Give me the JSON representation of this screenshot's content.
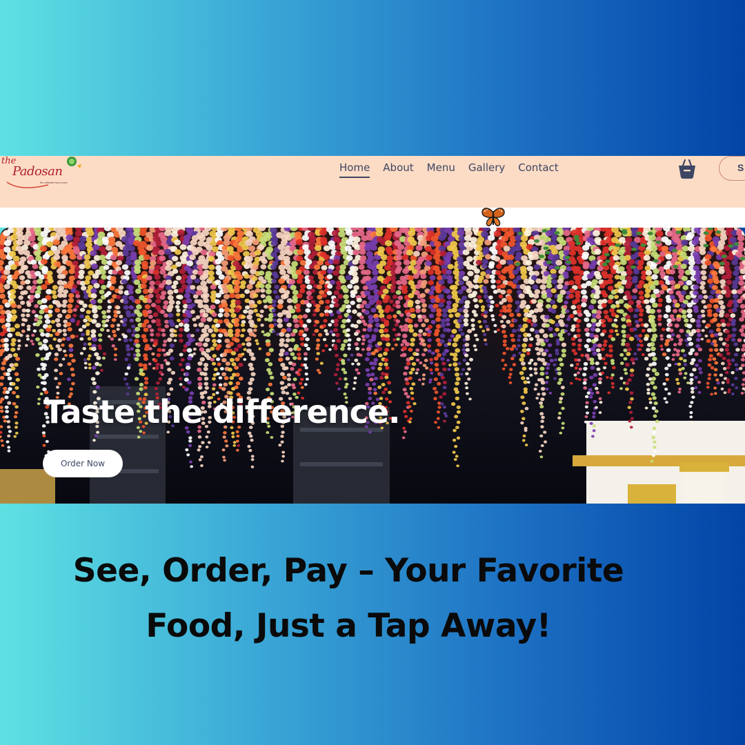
{
  "site": {
    "logo": {
      "the": "the",
      "name": "Padosan",
      "tagline": "the ultimate food court"
    },
    "nav": {
      "items": [
        {
          "label": "Home",
          "active": true
        },
        {
          "label": "About",
          "active": false
        },
        {
          "label": "Menu",
          "active": false
        },
        {
          "label": "Gallery",
          "active": false
        },
        {
          "label": "Contact",
          "active": false
        }
      ]
    },
    "cta_partial_label": "S",
    "hero": {
      "title": "Taste the difference.",
      "button_label": "Order Now"
    }
  },
  "caption": {
    "line1": "See, Order, Pay – Your Favorite",
    "line2": "Food, Just a Tap Away!"
  },
  "icons": {
    "cart": "shopping-basket-icon",
    "butterfly": "butterfly-icon"
  },
  "colors": {
    "nav_bg": "#fcdcc5",
    "nav_text": "#3d4663",
    "gradient_left": "#5ee1e3",
    "gradient_right": "#0244a6"
  }
}
